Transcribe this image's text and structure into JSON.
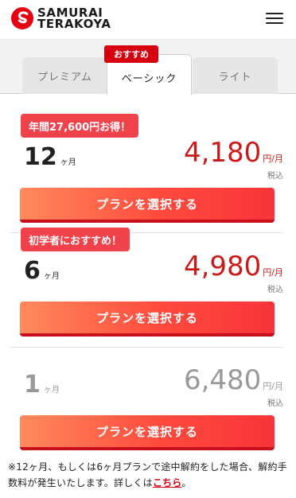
{
  "header": {
    "logo_line1": "SAMURAI",
    "logo_line2": "TERAKOYA"
  },
  "tabs": {
    "items": [
      {
        "label": "プレミアム"
      },
      {
        "label": "ベーシック"
      },
      {
        "label": "ライト"
      }
    ],
    "recommend_badge": "おすすめ"
  },
  "plans": [
    {
      "badge": "年間27,600円お得！",
      "months": "12",
      "months_unit": "ヶ月",
      "price": "4,180",
      "per": "円/月",
      "tax": "税込",
      "button": "プランを選択する"
    },
    {
      "badge": "初学者におすすめ！",
      "months": "6",
      "months_unit": "ヶ月",
      "price": "4,980",
      "per": "円/月",
      "tax": "税込",
      "button": "プランを選択する"
    },
    {
      "months": "1",
      "months_unit": "ヶ月",
      "price": "6,480",
      "per": "円/月",
      "tax": "税込",
      "button": "プランを選択する"
    }
  ],
  "note": {
    "text": "※12ヶ月、もしくは6ヶ月プランで途中解約をした場合、解約手数料が発生いたします。詳しくは",
    "link": "こちら",
    "end": "。"
  },
  "colors": {
    "accent_red": "#d7000f",
    "price_red": "#cc1a1a",
    "badge_red": "#f0424b",
    "muted": "#999999"
  }
}
